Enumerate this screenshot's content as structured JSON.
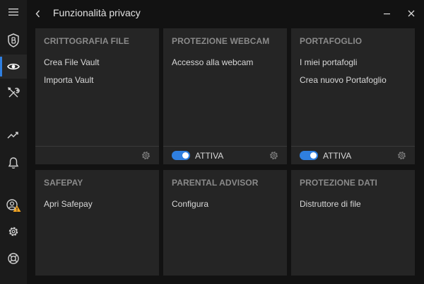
{
  "window": {
    "title": "Funzionalità privacy",
    "back_icon": "chevron-left-icon",
    "minimize_icon": "minimize-icon",
    "close_icon": "close-icon"
  },
  "sidebar": {
    "items": [
      {
        "name": "menu",
        "icon": "hamburger-menu-icon",
        "active": false
      },
      {
        "name": "protection",
        "icon": "shield-b-icon",
        "active": false
      },
      {
        "name": "privacy",
        "icon": "eye-icon",
        "active": true
      },
      {
        "name": "utilities",
        "icon": "tools-icon",
        "active": false
      },
      {
        "name": "activity",
        "icon": "activity-chart-icon",
        "active": false
      },
      {
        "name": "notifications",
        "icon": "bell-icon",
        "active": false
      },
      {
        "name": "account",
        "icon": "account-warning-icon",
        "active": false
      },
      {
        "name": "settings",
        "icon": "gear-icon",
        "active": false
      },
      {
        "name": "support",
        "icon": "lifebuoy-icon",
        "active": false
      }
    ]
  },
  "cards": {
    "crittografia": {
      "title": "CRITTOGRAFIA FILE",
      "links": [
        "Crea File Vault",
        "Importa Vault"
      ]
    },
    "webcam": {
      "title": "PROTEZIONE WEBCAM",
      "links": [
        "Accesso alla webcam"
      ],
      "toggle_label": "ATTIVA",
      "toggle_on": true
    },
    "portafoglio": {
      "title": "PORTAFOGLIO",
      "links": [
        "I miei portafogli",
        "Crea nuovo Portafoglio"
      ],
      "toggle_label": "ATTIVA",
      "toggle_on": true
    },
    "safepay": {
      "title": "SAFEPAY",
      "links": [
        "Apri Safepay"
      ]
    },
    "parental": {
      "title": "PARENTAL ADVISOR",
      "links": [
        "Configura"
      ]
    },
    "protezione_dati": {
      "title": "PROTEZIONE DATI",
      "links": [
        "Distruttore di file"
      ]
    }
  },
  "colors": {
    "accent": "#2f7fe0",
    "background": "#121212",
    "card": "#252525",
    "warning": "#f5a623"
  }
}
